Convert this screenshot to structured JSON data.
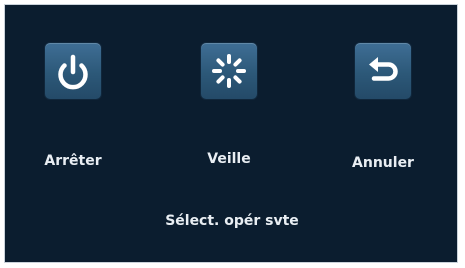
{
  "dialog": {
    "buttons": [
      {
        "id": "shutdown",
        "label": "Arrêter",
        "icon": "power-icon"
      },
      {
        "id": "standby",
        "label": "Veille",
        "icon": "standby-spinner-icon"
      },
      {
        "id": "cancel",
        "label": "Annuler",
        "icon": "return-arrow-icon"
      }
    ],
    "prompt": "Sélect. opér svte"
  },
  "colors": {
    "background": "#0b1d2f",
    "button": "#2f5c80",
    "text": "#e9eef3"
  }
}
